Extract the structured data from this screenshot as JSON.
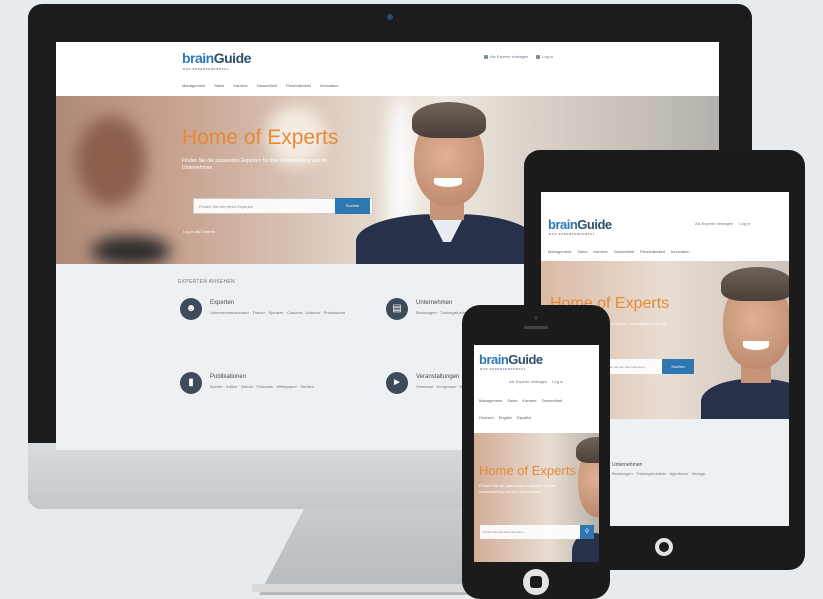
{
  "site": {
    "logo_brain": "brain",
    "logo_guide": "Guide",
    "tagline": "DAS EXPERTENPORTAL",
    "usernav": {
      "register": "Als Experte eintragen",
      "login": "Log in"
    },
    "nav": [
      "Management",
      "Sales",
      "Karriere",
      "Gesundheit",
      "Persönlichkeit",
      "Innovation"
    ],
    "lang": [
      "Deutsch",
      "English",
      "Español"
    ]
  },
  "hero": {
    "title": "Home of Experts",
    "subtitle": "Finden Sie die passenden Experten für Ihre Veranstaltung und Ihr Unternehmen",
    "search_placeholder": "Finden Sie hier Ihren Experten",
    "search_button": "Suchen",
    "login_note": "Log in als Experte"
  },
  "categories": {
    "heading": "EXPERTEN ANSEHEN",
    "items": [
      {
        "icon": "user-icon",
        "title": "Experten",
        "desc": "Unternehmensberater · Trainer · Speaker · Coaches · Autoren · Professoren"
      },
      {
        "icon": "document-icon",
        "title": "Unternehmen",
        "desc": "Beratungen · Trainingsinstitute · Agenturen · Verlage"
      },
      {
        "icon": "book-icon",
        "title": "Publikationen",
        "desc": "Bücher · Artikel · Videos · Podcasts · Whitepaper · Studien"
      },
      {
        "icon": "megaphone-icon",
        "title": "Veranstaltungen",
        "desc": "Seminare · Kongresse · Webinare"
      }
    ]
  },
  "colors": {
    "brand_blue": "#2e78b2",
    "accent_orange": "#e68a36",
    "dark": "#1c1c1e"
  }
}
